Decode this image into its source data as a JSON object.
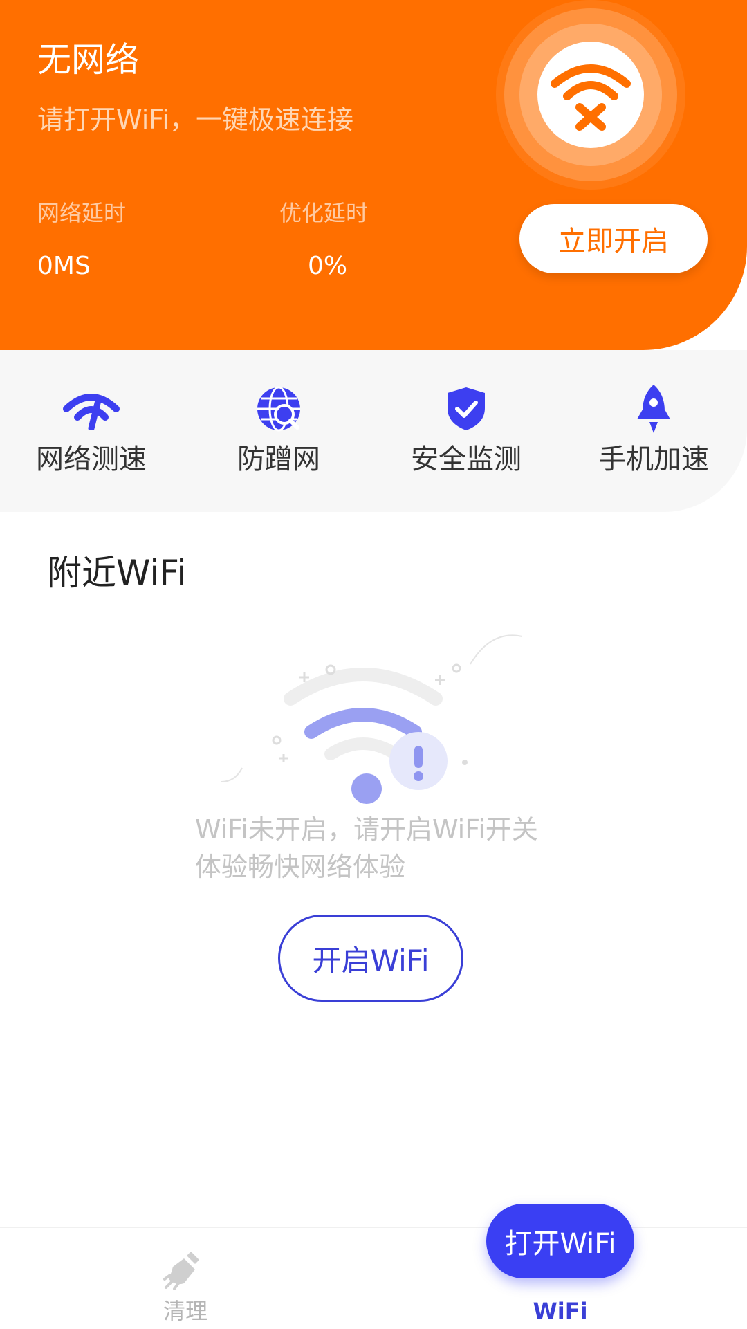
{
  "header": {
    "status_title": "无网络",
    "status_subtitle": "请打开WiFi，一键极速连接",
    "latency_label": "网络延时",
    "latency_value": "0MS",
    "optimize_label": "优化延时",
    "optimize_value": "0%",
    "open_now_label": "立即开启",
    "status_icon": "wifi-off-icon"
  },
  "tools": [
    {
      "label": "网络测速",
      "icon": "speedometer-icon"
    },
    {
      "label": "防蹭网",
      "icon": "globe-search-icon"
    },
    {
      "label": "安全监测",
      "icon": "shield-check-icon"
    },
    {
      "label": "手机加速",
      "icon": "rocket-icon"
    }
  ],
  "nearby": {
    "title": "附近WiFi",
    "empty_line1": "WiFi未开启，请开启WiFi开关",
    "empty_line2": "体验畅快网络体验",
    "open_wifi_label": "开启WiFi"
  },
  "bottom_nav": {
    "items": [
      {
        "label": "清理",
        "icon": "broom-icon",
        "active": false
      },
      {
        "label": "WiFi",
        "icon": "wifi-icon",
        "active": true
      }
    ],
    "fab_label": "打开WiFi"
  },
  "colors": {
    "header_orange": "#ff6f00",
    "accent_blue": "#3a3fd6",
    "fab_blue": "#3a3ff3",
    "tool_blue": "#3d3ff0"
  }
}
